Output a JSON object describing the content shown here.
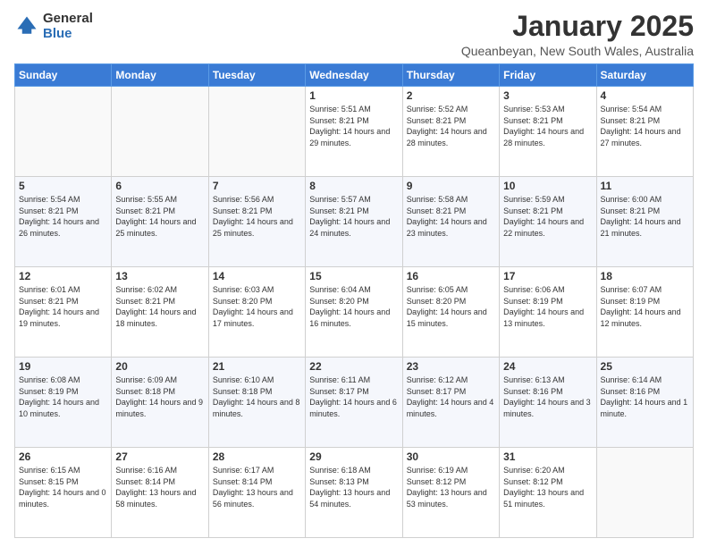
{
  "header": {
    "logo_general": "General",
    "logo_blue": "Blue",
    "month_title": "January 2025",
    "subtitle": "Queanbeyan, New South Wales, Australia"
  },
  "days_of_week": [
    "Sunday",
    "Monday",
    "Tuesday",
    "Wednesday",
    "Thursday",
    "Friday",
    "Saturday"
  ],
  "weeks": [
    [
      {
        "num": "",
        "sunrise": "",
        "sunset": "",
        "daylight": ""
      },
      {
        "num": "",
        "sunrise": "",
        "sunset": "",
        "daylight": ""
      },
      {
        "num": "",
        "sunrise": "",
        "sunset": "",
        "daylight": ""
      },
      {
        "num": "1",
        "sunrise": "Sunrise: 5:51 AM",
        "sunset": "Sunset: 8:21 PM",
        "daylight": "Daylight: 14 hours and 29 minutes."
      },
      {
        "num": "2",
        "sunrise": "Sunrise: 5:52 AM",
        "sunset": "Sunset: 8:21 PM",
        "daylight": "Daylight: 14 hours and 28 minutes."
      },
      {
        "num": "3",
        "sunrise": "Sunrise: 5:53 AM",
        "sunset": "Sunset: 8:21 PM",
        "daylight": "Daylight: 14 hours and 28 minutes."
      },
      {
        "num": "4",
        "sunrise": "Sunrise: 5:54 AM",
        "sunset": "Sunset: 8:21 PM",
        "daylight": "Daylight: 14 hours and 27 minutes."
      }
    ],
    [
      {
        "num": "5",
        "sunrise": "Sunrise: 5:54 AM",
        "sunset": "Sunset: 8:21 PM",
        "daylight": "Daylight: 14 hours and 26 minutes."
      },
      {
        "num": "6",
        "sunrise": "Sunrise: 5:55 AM",
        "sunset": "Sunset: 8:21 PM",
        "daylight": "Daylight: 14 hours and 25 minutes."
      },
      {
        "num": "7",
        "sunrise": "Sunrise: 5:56 AM",
        "sunset": "Sunset: 8:21 PM",
        "daylight": "Daylight: 14 hours and 25 minutes."
      },
      {
        "num": "8",
        "sunrise": "Sunrise: 5:57 AM",
        "sunset": "Sunset: 8:21 PM",
        "daylight": "Daylight: 14 hours and 24 minutes."
      },
      {
        "num": "9",
        "sunrise": "Sunrise: 5:58 AM",
        "sunset": "Sunset: 8:21 PM",
        "daylight": "Daylight: 14 hours and 23 minutes."
      },
      {
        "num": "10",
        "sunrise": "Sunrise: 5:59 AM",
        "sunset": "Sunset: 8:21 PM",
        "daylight": "Daylight: 14 hours and 22 minutes."
      },
      {
        "num": "11",
        "sunrise": "Sunrise: 6:00 AM",
        "sunset": "Sunset: 8:21 PM",
        "daylight": "Daylight: 14 hours and 21 minutes."
      }
    ],
    [
      {
        "num": "12",
        "sunrise": "Sunrise: 6:01 AM",
        "sunset": "Sunset: 8:21 PM",
        "daylight": "Daylight: 14 hours and 19 minutes."
      },
      {
        "num": "13",
        "sunrise": "Sunrise: 6:02 AM",
        "sunset": "Sunset: 8:21 PM",
        "daylight": "Daylight: 14 hours and 18 minutes."
      },
      {
        "num": "14",
        "sunrise": "Sunrise: 6:03 AM",
        "sunset": "Sunset: 8:20 PM",
        "daylight": "Daylight: 14 hours and 17 minutes."
      },
      {
        "num": "15",
        "sunrise": "Sunrise: 6:04 AM",
        "sunset": "Sunset: 8:20 PM",
        "daylight": "Daylight: 14 hours and 16 minutes."
      },
      {
        "num": "16",
        "sunrise": "Sunrise: 6:05 AM",
        "sunset": "Sunset: 8:20 PM",
        "daylight": "Daylight: 14 hours and 15 minutes."
      },
      {
        "num": "17",
        "sunrise": "Sunrise: 6:06 AM",
        "sunset": "Sunset: 8:19 PM",
        "daylight": "Daylight: 14 hours and 13 minutes."
      },
      {
        "num": "18",
        "sunrise": "Sunrise: 6:07 AM",
        "sunset": "Sunset: 8:19 PM",
        "daylight": "Daylight: 14 hours and 12 minutes."
      }
    ],
    [
      {
        "num": "19",
        "sunrise": "Sunrise: 6:08 AM",
        "sunset": "Sunset: 8:19 PM",
        "daylight": "Daylight: 14 hours and 10 minutes."
      },
      {
        "num": "20",
        "sunrise": "Sunrise: 6:09 AM",
        "sunset": "Sunset: 8:18 PM",
        "daylight": "Daylight: 14 hours and 9 minutes."
      },
      {
        "num": "21",
        "sunrise": "Sunrise: 6:10 AM",
        "sunset": "Sunset: 8:18 PM",
        "daylight": "Daylight: 14 hours and 8 minutes."
      },
      {
        "num": "22",
        "sunrise": "Sunrise: 6:11 AM",
        "sunset": "Sunset: 8:17 PM",
        "daylight": "Daylight: 14 hours and 6 minutes."
      },
      {
        "num": "23",
        "sunrise": "Sunrise: 6:12 AM",
        "sunset": "Sunset: 8:17 PM",
        "daylight": "Daylight: 14 hours and 4 minutes."
      },
      {
        "num": "24",
        "sunrise": "Sunrise: 6:13 AM",
        "sunset": "Sunset: 8:16 PM",
        "daylight": "Daylight: 14 hours and 3 minutes."
      },
      {
        "num": "25",
        "sunrise": "Sunrise: 6:14 AM",
        "sunset": "Sunset: 8:16 PM",
        "daylight": "Daylight: 14 hours and 1 minute."
      }
    ],
    [
      {
        "num": "26",
        "sunrise": "Sunrise: 6:15 AM",
        "sunset": "Sunset: 8:15 PM",
        "daylight": "Daylight: 14 hours and 0 minutes."
      },
      {
        "num": "27",
        "sunrise": "Sunrise: 6:16 AM",
        "sunset": "Sunset: 8:14 PM",
        "daylight": "Daylight: 13 hours and 58 minutes."
      },
      {
        "num": "28",
        "sunrise": "Sunrise: 6:17 AM",
        "sunset": "Sunset: 8:14 PM",
        "daylight": "Daylight: 13 hours and 56 minutes."
      },
      {
        "num": "29",
        "sunrise": "Sunrise: 6:18 AM",
        "sunset": "Sunset: 8:13 PM",
        "daylight": "Daylight: 13 hours and 54 minutes."
      },
      {
        "num": "30",
        "sunrise": "Sunrise: 6:19 AM",
        "sunset": "Sunset: 8:12 PM",
        "daylight": "Daylight: 13 hours and 53 minutes."
      },
      {
        "num": "31",
        "sunrise": "Sunrise: 6:20 AM",
        "sunset": "Sunset: 8:12 PM",
        "daylight": "Daylight: 13 hours and 51 minutes."
      },
      {
        "num": "",
        "sunrise": "",
        "sunset": "",
        "daylight": ""
      }
    ]
  ]
}
